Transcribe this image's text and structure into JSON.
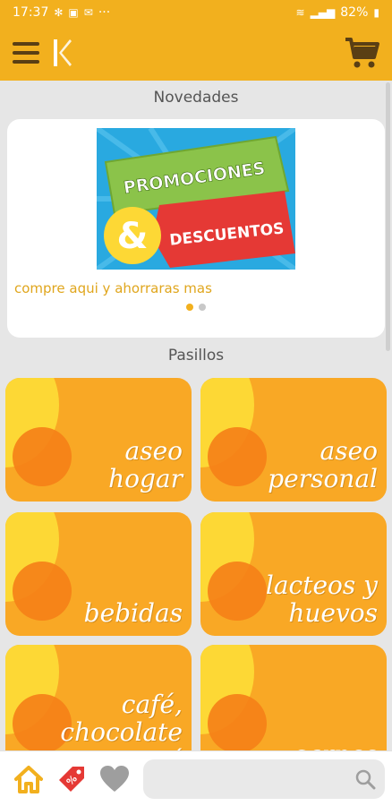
{
  "status_bar": {
    "time": "17:37",
    "battery": "82%",
    "more": "···"
  },
  "app": {
    "logo_letter": "K"
  },
  "sections": {
    "news_title": "Novedades",
    "aisles_title": "Pasillos"
  },
  "promo": {
    "banner_line1": "PROMOCIONES",
    "banner_amp": "&",
    "banner_line2": "DESCUENTOS",
    "caption": "compre aqui y ahorraras mas",
    "slide_count": 2,
    "active_slide": 1
  },
  "aisles": [
    {
      "label": "aseo\nhogar"
    },
    {
      "label": "aseo\npersonal"
    },
    {
      "label": "bebidas"
    },
    {
      "label": "lacteos y\nhuevos"
    },
    {
      "label": "café,\nchocolate\ny té"
    },
    {
      "label": "carnes"
    }
  ],
  "bottom_nav": {
    "search_placeholder": ""
  },
  "colors": {
    "accent": "#f2b01e",
    "tile": "#f9a825",
    "tile_sun": "#fdd835",
    "tile_ball": "#f57f17",
    "sale_icon": "#e53935"
  },
  "icons": [
    "menu-icon",
    "cart-icon",
    "home-icon",
    "sale-tag-icon",
    "heart-icon",
    "search-icon"
  ]
}
